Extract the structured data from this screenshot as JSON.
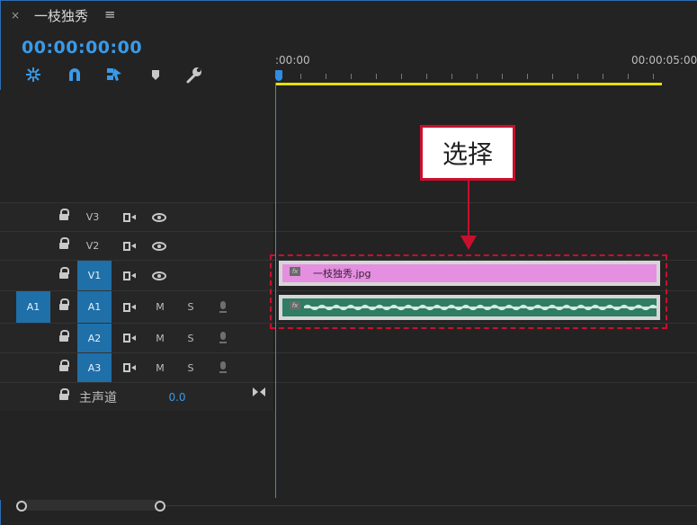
{
  "panel": {
    "close_glyph": "×",
    "title": "一枝独秀",
    "menu_glyph": "≡"
  },
  "timecode": "00:00:00:00",
  "toolbar": {
    "tools": [
      {
        "name": "nest-sequence-icon"
      },
      {
        "name": "snap-magnet-icon"
      },
      {
        "name": "linked-selection-icon"
      },
      {
        "name": "add-marker-icon"
      },
      {
        "name": "timeline-settings-wrench-icon"
      }
    ]
  },
  "ruler": {
    "start_label": ":00:00",
    "end_label": "00:00:05:00"
  },
  "tracks": {
    "v3": {
      "label": "V3"
    },
    "v2": {
      "label": "V2"
    },
    "v1": {
      "label": "V1"
    },
    "a1": {
      "source_label": "A1",
      "label": "A1",
      "mute": "M",
      "solo": "S"
    },
    "a2": {
      "label": "A2",
      "mute": "M",
      "solo": "S"
    },
    "a3": {
      "label": "A3",
      "mute": "M",
      "solo": "S"
    },
    "master": {
      "label": "主声道",
      "value": "0.0"
    }
  },
  "clips": {
    "video": {
      "name": "一枝独秀.jpg",
      "fx": "fx"
    },
    "audio": {
      "fx": "fx"
    }
  },
  "annotation": {
    "callout_text": "选择"
  },
  "colors": {
    "accent_blue": "#2f8de4",
    "work_area_yellow": "#e8e000",
    "video_clip": "#e58fe0",
    "audio_clip": "#2f7d62",
    "annotation_red": "#c8102e"
  }
}
